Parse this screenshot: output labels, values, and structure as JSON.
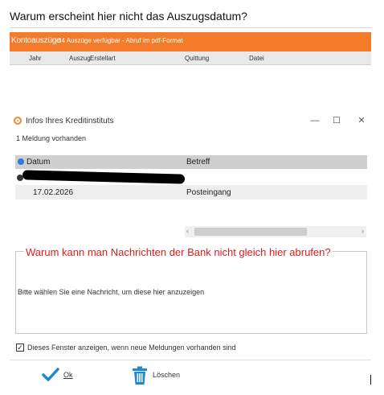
{
  "question_top": "Warum erscheint hier nicht das Auszugsdatum?",
  "bank_panel": {
    "title": "Kontoauszüge",
    "subtitle": "34 Auszüge verfügbar - Abruf im pdf-Format",
    "columns": [
      "Jahr",
      "Auszug",
      "Erstellart",
      "Quittung",
      "Datei"
    ],
    "accent_color": "#f47b2a"
  },
  "dialog": {
    "title": "Infos Ihres Kreditinstituts",
    "icon": "bank-info-icon",
    "window_buttons": {
      "minimize": "—",
      "maximize": "☐",
      "close": "✕"
    },
    "message_count": "1 Meldung vorhanden",
    "table": {
      "headers": {
        "datum": "Datum",
        "betreff": "Betreff"
      },
      "rows": [
        {
          "datum": "17.02.2026",
          "betreff": "Posteingang"
        }
      ]
    },
    "scroll": {
      "left": "‹",
      "right": "›"
    },
    "message_placeholder": "Bitte wählen Sie eine Nachricht, um diese hier anzuzeigen",
    "show_window_checkbox": {
      "checked": true,
      "label": "Dieses Fenster anzeigen, wenn neue Meldungen vorhanden sind"
    },
    "buttons": {
      "ok": "Ok",
      "delete": "Löschen"
    }
  },
  "question_bottom": "Warum kann man Nachrichten der Bank nicht gleich hier abrufen?"
}
